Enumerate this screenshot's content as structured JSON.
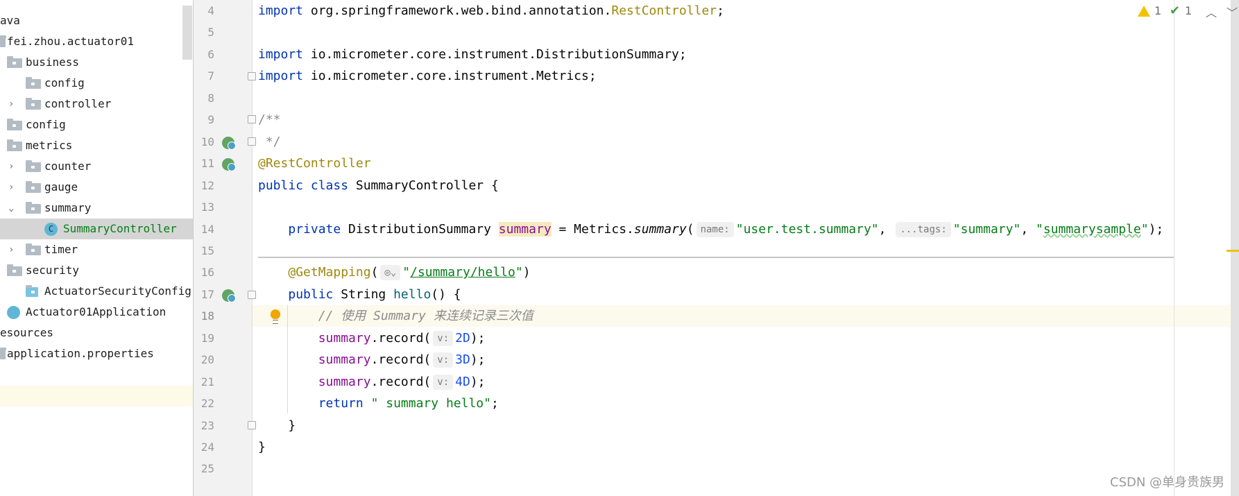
{
  "project_tree": {
    "items": [
      {
        "label": "ava",
        "depth": 0,
        "icon": "none",
        "chevron": ""
      },
      {
        "label": "fei.zhou.actuator01",
        "depth": 0,
        "icon": "package-icon",
        "chevron": ""
      },
      {
        "label": "business",
        "depth": 1,
        "icon": "folder-icon",
        "chevron": ""
      },
      {
        "label": "config",
        "depth": 2,
        "icon": "folder-icon",
        "chevron": ""
      },
      {
        "label": "controller",
        "depth": 2,
        "icon": "folder-icon",
        "chevron": "right"
      },
      {
        "label": "config",
        "depth": 1,
        "icon": "folder-icon",
        "chevron": ""
      },
      {
        "label": "metrics",
        "depth": 1,
        "icon": "folder-icon",
        "chevron": ""
      },
      {
        "label": "counter",
        "depth": 2,
        "icon": "folder-icon",
        "chevron": "right"
      },
      {
        "label": "gauge",
        "depth": 2,
        "icon": "folder-icon",
        "chevron": "right"
      },
      {
        "label": "summary",
        "depth": 2,
        "icon": "folder-icon",
        "chevron": "down"
      },
      {
        "label": "SummaryController",
        "depth": 3,
        "icon": "class-icon",
        "chevron": "",
        "selected": true
      },
      {
        "label": "timer",
        "depth": 2,
        "icon": "folder-icon",
        "chevron": "right"
      },
      {
        "label": "security",
        "depth": 1,
        "icon": "folder-icon",
        "chevron": ""
      },
      {
        "label": "ActuatorSecurityConfig",
        "depth": 2,
        "icon": "java-file-icon",
        "chevron": ""
      },
      {
        "label": "Actuator01Application",
        "depth": 1,
        "icon": "spring-app-icon",
        "chevron": ""
      },
      {
        "label": "esources",
        "depth": 0,
        "icon": "none",
        "chevron": ""
      },
      {
        "label": "application.properties",
        "depth": 0,
        "icon": "properties-icon",
        "chevron": ""
      }
    ],
    "class_icon_letter": "C"
  },
  "editor": {
    "current_line": 18,
    "lines": [
      {
        "n": "4",
        "tokens": [
          {
            "c": "kw",
            "t": "import"
          },
          {
            "c": "",
            "t": " org.springframework.web.bind.annotation."
          },
          {
            "c": "ann",
            "t": "RestController"
          },
          {
            "c": "",
            "t": ";"
          }
        ]
      },
      {
        "n": "5",
        "tokens": []
      },
      {
        "n": "6",
        "tokens": [
          {
            "c": "kw",
            "t": "import"
          },
          {
            "c": "",
            "t": " io.micrometer.core.instrument.DistributionSummary;"
          }
        ]
      },
      {
        "n": "7",
        "tokens": [
          {
            "c": "kw",
            "t": "import"
          },
          {
            "c": "",
            "t": " io.micrometer.core.instrument.Metrics;"
          }
        ]
      },
      {
        "n": "8",
        "tokens": []
      },
      {
        "n": "9",
        "tokens": [
          {
            "c": "doc",
            "t": "/**"
          }
        ]
      },
      {
        "n": "10",
        "tokens": [
          {
            "c": "doc",
            "t": " */"
          }
        ]
      },
      {
        "n": "11",
        "tokens": [
          {
            "c": "ann",
            "t": "@RestController"
          }
        ]
      },
      {
        "n": "12",
        "tokens": [
          {
            "c": "kw",
            "t": "public class"
          },
          {
            "c": "",
            "t": " SummaryController {"
          }
        ]
      },
      {
        "n": "13",
        "tokens": []
      },
      {
        "n": "14",
        "tokens": [
          {
            "c": "",
            "t": "    "
          },
          {
            "c": "kw",
            "t": "private"
          },
          {
            "c": "",
            "t": " DistributionSummary "
          },
          {
            "c": "fld hlw",
            "t": "summary"
          },
          {
            "c": "",
            "t": " = Metrics."
          },
          {
            "c": "ital",
            "t": "summary"
          },
          {
            "c": "",
            "t": "("
          },
          {
            "c": "hint",
            "t": "name:"
          },
          {
            "c": "str",
            "t": "\"user.test.summary\""
          },
          {
            "c": "",
            "t": ", "
          },
          {
            "c": "hint",
            "t": "...tags:"
          },
          {
            "c": "str",
            "t": "\"summary\""
          },
          {
            "c": "",
            "t": ", "
          },
          {
            "c": "str",
            "t": "\""
          },
          {
            "c": "str wavy",
            "t": "summarysample"
          },
          {
            "c": "str",
            "t": "\""
          },
          {
            "c": "",
            "t": ");"
          }
        ]
      },
      {
        "n": "15",
        "tokens": []
      },
      {
        "n": "16",
        "tokens": [
          {
            "c": "",
            "t": "    "
          },
          {
            "c": "ann",
            "t": "@GetMapping"
          },
          {
            "c": "",
            "t": "("
          },
          {
            "c": "hint",
            "t": "◎⌄"
          },
          {
            "c": "str",
            "t": "\""
          },
          {
            "c": "link",
            "t": "/summary/hello"
          },
          {
            "c": "str",
            "t": "\""
          },
          {
            "c": "",
            "t": ")"
          }
        ]
      },
      {
        "n": "17",
        "tokens": [
          {
            "c": "",
            "t": "    "
          },
          {
            "c": "kw",
            "t": "public"
          },
          {
            "c": "",
            "t": " String "
          },
          {
            "c": "mth",
            "t": "hello"
          },
          {
            "c": "",
            "t": "() {"
          }
        ]
      },
      {
        "n": "18",
        "tokens": [
          {
            "c": "",
            "t": "        "
          },
          {
            "c": "cmt",
            "t": "// 使用 Summary 来连续记录三次值"
          }
        ]
      },
      {
        "n": "19",
        "tokens": [
          {
            "c": "",
            "t": "        "
          },
          {
            "c": "fld",
            "t": "summary"
          },
          {
            "c": "",
            "t": ".record("
          },
          {
            "c": "hint",
            "t": "v:"
          },
          {
            "c": "num",
            "t": "2D"
          },
          {
            "c": "",
            "t": ");"
          }
        ]
      },
      {
        "n": "20",
        "tokens": [
          {
            "c": "",
            "t": "        "
          },
          {
            "c": "fld",
            "t": "summary"
          },
          {
            "c": "",
            "t": ".record("
          },
          {
            "c": "hint",
            "t": "v:"
          },
          {
            "c": "num",
            "t": "3D"
          },
          {
            "c": "",
            "t": ");"
          }
        ]
      },
      {
        "n": "21",
        "tokens": [
          {
            "c": "",
            "t": "        "
          },
          {
            "c": "fld",
            "t": "summary"
          },
          {
            "c": "",
            "t": ".record("
          },
          {
            "c": "hint",
            "t": "v:"
          },
          {
            "c": "num",
            "t": "4D"
          },
          {
            "c": "",
            "t": ");"
          }
        ]
      },
      {
        "n": "22",
        "tokens": [
          {
            "c": "",
            "t": "        "
          },
          {
            "c": "kw",
            "t": "return"
          },
          {
            "c": "",
            "t": " "
          },
          {
            "c": "str",
            "t": "\" summary hello\""
          },
          {
            "c": "",
            "t": ";"
          }
        ]
      },
      {
        "n": "23",
        "tokens": [
          {
            "c": "",
            "t": "    }"
          }
        ]
      },
      {
        "n": "24",
        "tokens": [
          {
            "c": "",
            "t": "}"
          }
        ]
      },
      {
        "n": "25",
        "tokens": []
      }
    ]
  },
  "inspections": {
    "warnings": "1",
    "weak_warnings": "1",
    "prev_icon": "chevron-up-icon",
    "next_icon": "chevron-down-icon",
    "warning_color": "#f2c300",
    "ok_color": "#4c9a4c"
  },
  "watermark": "CSDN @单身贵族男",
  "colors": {
    "keyword": "#0033b3",
    "annotation": "#9e880d",
    "string": "#067d17",
    "field": "#871094",
    "number": "#1750eb",
    "comment": "#8c8c8c",
    "current_line": "#fcfaed"
  }
}
